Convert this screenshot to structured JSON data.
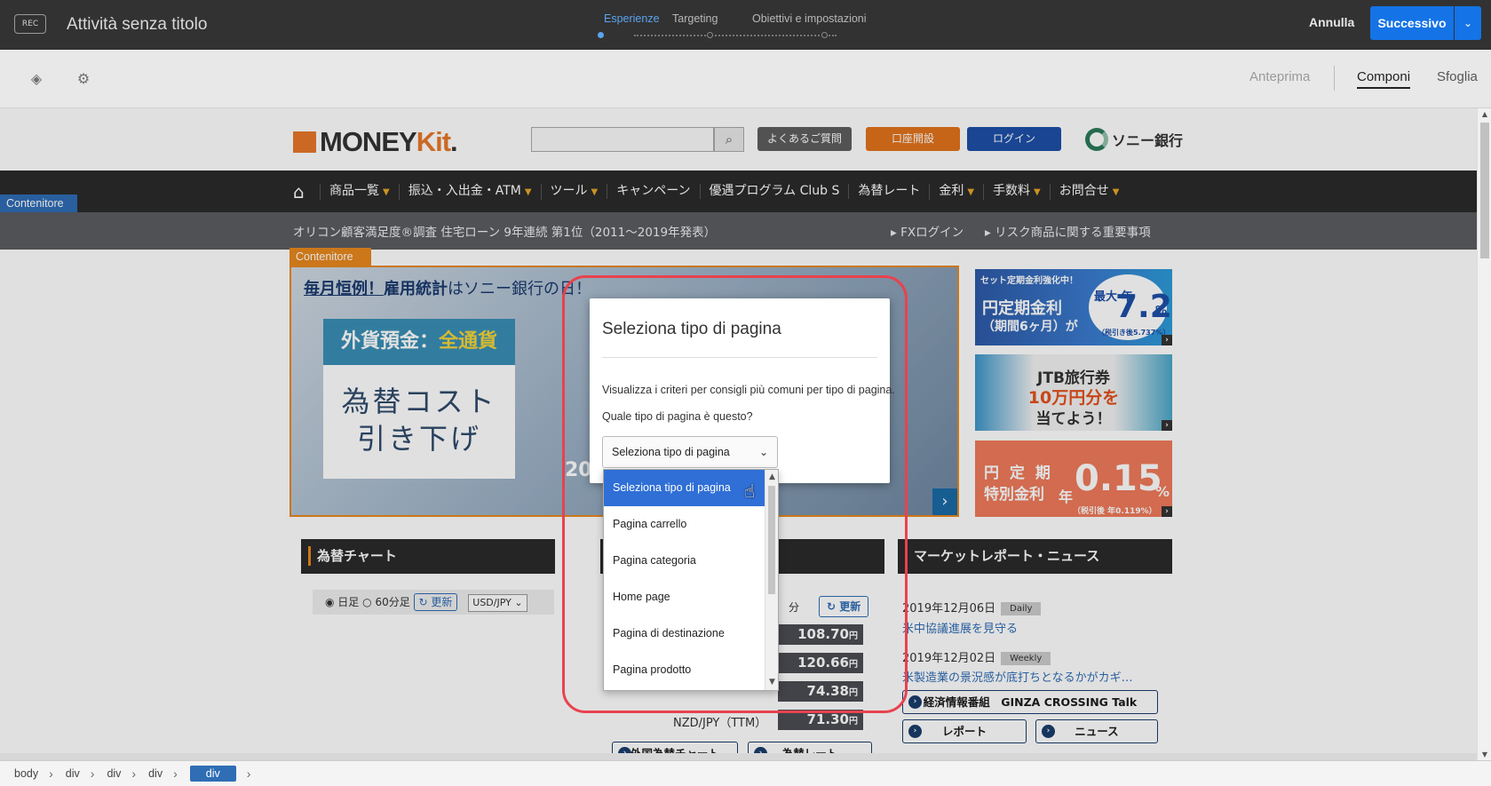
{
  "topbar": {
    "rec_label": "REC",
    "activity_title": "Attività senza titolo",
    "steps": [
      "Esperienze",
      "Targeting",
      "Obiettivi e impostazioni"
    ],
    "cancel_label": "Annulla",
    "next_label": "Successivo",
    "accent_color": "#1473e6"
  },
  "toolbar": {
    "modes": [
      "Anteprima",
      "Componi",
      "Sfoglia"
    ],
    "active_mode": "Componi",
    "icons": [
      "layers-icon",
      "gear-icon"
    ]
  },
  "site": {
    "logo_prefix": "MONEY",
    "logo_suffix": "Kit",
    "logo_dot": ".",
    "header_buttons": [
      "よくあるご質問",
      "口座開設",
      "ログイン"
    ],
    "bank_name": "ソニー銀行",
    "nav_items": [
      "商品一覧",
      "振込・入出金・ATM",
      "ツール",
      "キャンペーン",
      "優遇プログラム Club S",
      "為替レート",
      "金利",
      "手数料",
      "お問合せ"
    ],
    "container_label": "Contenitore",
    "subbar_text": "オリコン顧客満足度®調査 住宅ローン 9年連続 第1位（2011～2019年発表）",
    "subbar_links": [
      "FXログイン",
      "リスク商品に関する重要事項"
    ],
    "hero": {
      "headline_1": "毎月恒例！",
      "headline_2": "雇用統計",
      "headline_3": "はソニー銀行の日！",
      "box_title_a": "外貨預金：",
      "box_title_b": "全通貨",
      "box_body_1": "為替コスト",
      "box_body_2": "引き下げ",
      "year_fragment": "20"
    },
    "banners": [
      {
        "line1": "円定期金利",
        "line2": "（期間6ヶ月）が",
        "top": "セット定期金利強化中！",
        "big": "7.2",
        "prefix": "最大 年",
        "unit": "%",
        "note": "（税引き後5.737%）"
      },
      {
        "line1": "JTB旅行券",
        "line2": "10万円分を",
        "line3": "当てよう！"
      },
      {
        "line1": "円 定 期",
        "line2": "特別金利",
        "big": "0.15",
        "prefix": "年",
        "unit": "%",
        "note": "（税引後 年0.119%）"
      }
    ],
    "sections": [
      "為替チャート",
      "マーケットレポート・ニュース"
    ],
    "chart_controls": {
      "daily": "日足",
      "minute": "60分足",
      "update": "更新",
      "pair": "USD/JPY"
    },
    "rates_partial_label": "分",
    "rates_update": "更新",
    "rates": [
      {
        "value": "108.70",
        "unit": "円"
      },
      {
        "value": "120.66",
        "unit": "円"
      },
      {
        "value": "74.38",
        "unit": "円"
      },
      {
        "value": "71.30",
        "unit": "円"
      }
    ],
    "fx_partial_label": "NZD/JPY（TTM）",
    "fx_buttons": [
      "外国為替チャート",
      "為替レート"
    ],
    "news": [
      {
        "date": "2019年12月06日",
        "tag": "Daily",
        "title": "米中協議進展を見守る"
      },
      {
        "date": "2019年12月02日",
        "tag": "Weekly",
        "title": "米製造業の景況感が底打ちとなるかがカギ…"
      }
    ],
    "news_buttons": [
      "経済情報番組　GINZA CROSSING Talk",
      "レポート",
      "ニュース"
    ]
  },
  "modal": {
    "title": "Seleziona tipo di pagina",
    "description": "Visualizza i criteri per consigli più comuni per tipo di pagina.",
    "question": "Quale tipo di pagina è questo?",
    "select_value": "Seleziona tipo di pagina",
    "options": [
      "Seleziona tipo di pagina",
      "Pagina carrello",
      "Pagina categoria",
      "Home page",
      "Pagina di destinazione",
      "Pagina prodotto"
    ],
    "selected_index": 0
  },
  "breadcrumb": [
    "body",
    "div",
    "div",
    "div",
    "div"
  ],
  "colors": {
    "highlight_ring": "#e8424e",
    "container_tag_blue": "#2f6db5",
    "container_tag_orange": "#e8881e"
  }
}
